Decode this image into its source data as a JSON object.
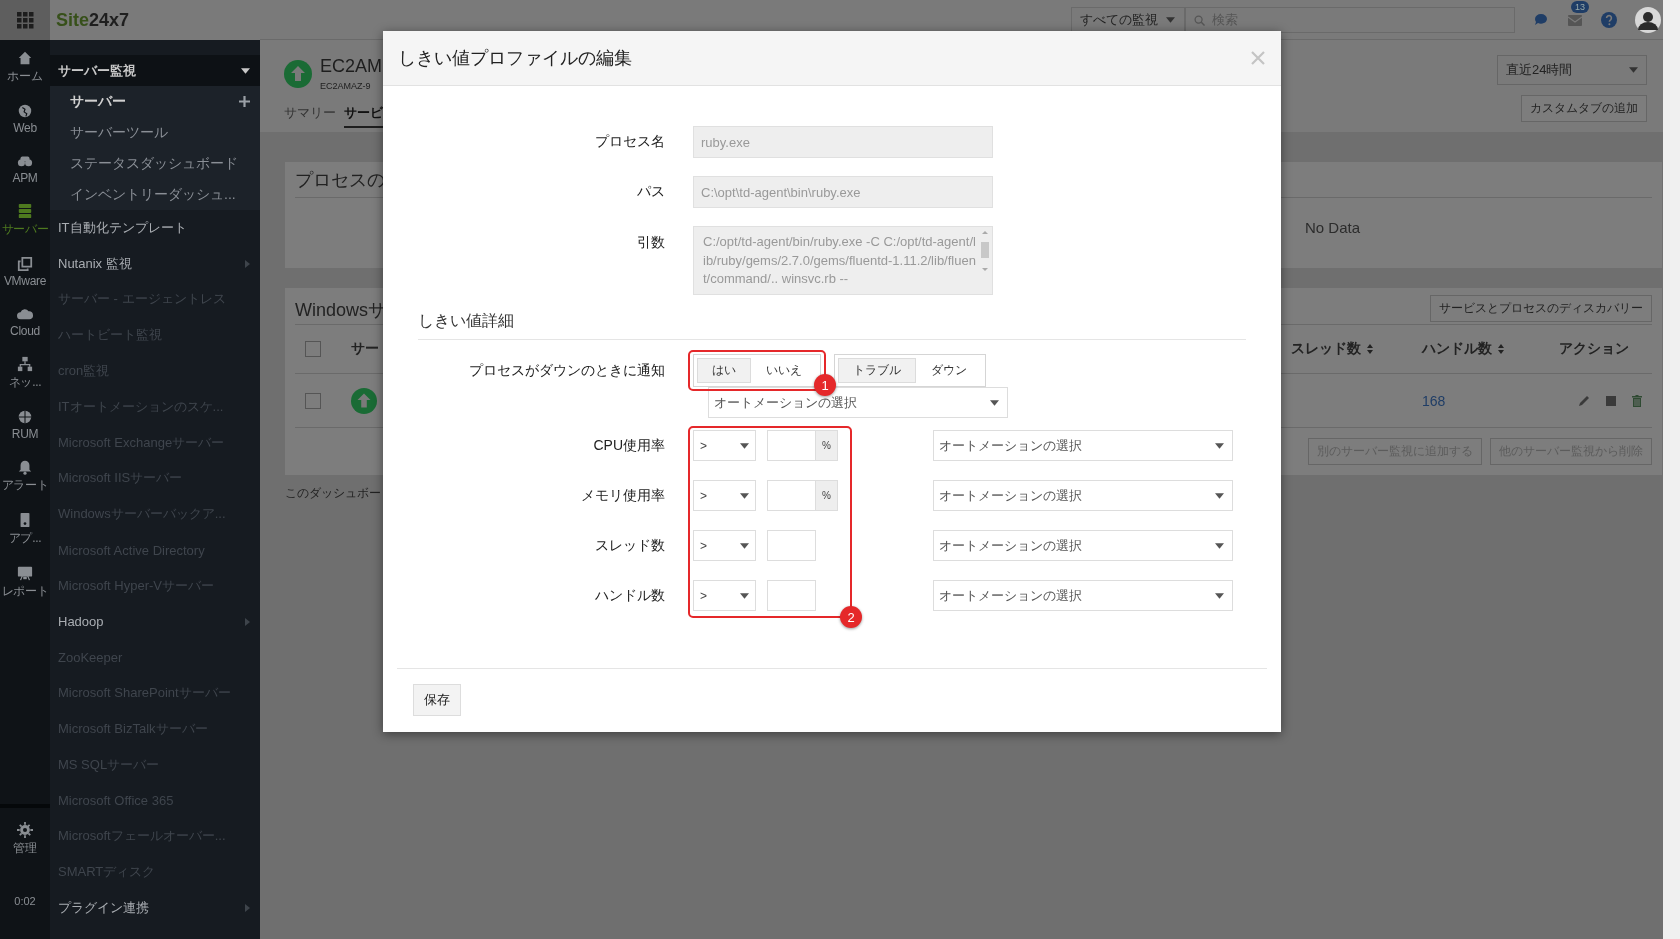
{
  "topbar": {
    "logo_first": "Site",
    "logo_second": "24x7",
    "monitor_filter": "すべての監視",
    "search": {
      "placeholder": "検索"
    },
    "notification_count": "13"
  },
  "icon_rail": [
    {
      "label": "ホーム",
      "selected": false
    },
    {
      "label": "Web",
      "selected": false
    },
    {
      "label": "APM",
      "selected": false
    },
    {
      "label": "サーバー",
      "selected": true
    },
    {
      "label": "VMware",
      "selected": false
    },
    {
      "label": "Cloud",
      "selected": false
    },
    {
      "label": "ネッ...",
      "selected": false
    },
    {
      "label": "RUM",
      "selected": false
    },
    {
      "label": "アラート",
      "selected": false
    },
    {
      "label": "アプ...",
      "selected": false
    },
    {
      "label": "レポート",
      "selected": false
    }
  ],
  "rail_bottom": {
    "admin": "管理",
    "time": "0:02"
  },
  "menu": [
    {
      "label": "サーバー監視",
      "kind": "group",
      "expanded": true,
      "children": [
        {
          "label": "サーバー",
          "selected": true
        },
        {
          "label": "サーバーツール",
          "selected": false
        },
        {
          "label": "ステータスダッシュボード",
          "selected": false
        },
        {
          "label": "インベントリーダッシュ...",
          "selected": false
        }
      ]
    },
    {
      "label": "IT自動化テンプレート",
      "kind": "item",
      "disabled": false
    },
    {
      "label": "Nutanix 監視",
      "kind": "category",
      "disabled": false
    },
    {
      "label": "サーバー - エージェントレス",
      "kind": "item",
      "disabled": true
    },
    {
      "label": "ハートビート監視",
      "kind": "item",
      "disabled": true
    },
    {
      "label": "cron監視",
      "kind": "item",
      "disabled": true
    },
    {
      "label": "ITオートメーションのスケ...",
      "kind": "item",
      "disabled": true
    },
    {
      "label": "Microsoft Exchangeサーバー",
      "kind": "item",
      "disabled": true
    },
    {
      "label": "Microsoft IISサーバー",
      "kind": "item",
      "disabled": true
    },
    {
      "label": "Windowsサーバーバックア...",
      "kind": "item",
      "disabled": true
    },
    {
      "label": "Microsoft Active Directory",
      "kind": "item",
      "disabled": true
    },
    {
      "label": "Microsoft Hyper-Vサーバー",
      "kind": "item",
      "disabled": true
    },
    {
      "label": "Hadoop",
      "kind": "category",
      "disabled": false
    },
    {
      "label": "ZooKeeper",
      "kind": "item",
      "disabled": true
    },
    {
      "label": "Microsoft SharePointサーバー",
      "kind": "item",
      "disabled": true
    },
    {
      "label": "Microsoft BizTalkサーバー",
      "kind": "item",
      "disabled": true
    },
    {
      "label": "MS SQLサーバー",
      "kind": "item",
      "disabled": true
    },
    {
      "label": "Microsoft Office 365",
      "kind": "item",
      "disabled": true
    },
    {
      "label": "Microsoftフェールオーバー...",
      "kind": "item",
      "disabled": true
    },
    {
      "label": "SMARTディスク",
      "kind": "item",
      "disabled": true
    },
    {
      "label": "プラグイン連携",
      "kind": "category",
      "disabled": false
    }
  ],
  "monitor_header": {
    "title": "EC2AM",
    "subtitle": "EC2AMAZ-9",
    "tabs": [
      {
        "label": "サマリー",
        "selected": false
      },
      {
        "label": "サービ",
        "selected": true
      }
    ],
    "time_range": "直近24時間",
    "custom_tab_button": "カスタムタブの追加"
  },
  "process_panel": {
    "title": "プロセスの",
    "empty_text": "No Data"
  },
  "services_panel": {
    "title": "Windowsサ",
    "discovery_button": "サービスとプロセスのディスカバリー",
    "select_all_checked": false,
    "columns": [
      "サー",
      "スレッド数",
      "ハンドル数",
      "アクション"
    ],
    "rows": [
      {
        "checked": false,
        "handles": "168"
      }
    ],
    "buttons": [
      "別のサーバー監視に追加する",
      "他のサーバー監視から削除"
    ],
    "footer_note": "このダッシュボー"
  },
  "modal": {
    "title": "しきい値プロファイルの編集",
    "fields": [
      {
        "label": "プロセス名",
        "value": "ruby.exe",
        "kind": "text"
      },
      {
        "label": "パス",
        "value": "C:\\opt\\td-agent\\bin\\ruby.exe",
        "kind": "text"
      },
      {
        "label": "引数",
        "value": "C:/opt/td-agent/bin/ruby.exe  -C  C:/opt/td-agent/lib/ruby/gems/2.7.0/gems/fluentd-1.11.2/lib/fluent/command/..  winsvc.rb --",
        "kind": "textarea"
      }
    ],
    "section_title": "しきい値詳細",
    "notify": {
      "label": "プロセスがダウンのときに通知",
      "options": [
        {
          "label": "はい",
          "selected": true
        },
        {
          "label": "いいえ",
          "selected": false
        }
      ],
      "severity": [
        {
          "label": "トラブル",
          "selected": true
        },
        {
          "label": "ダウン",
          "selected": false
        }
      ],
      "automation": "オートメーションの選択",
      "callout": "1"
    },
    "thresholds": {
      "callout": "2",
      "rows": [
        {
          "label": "CPU使用率",
          "operator": ">",
          "unit": "%",
          "automation": "オートメーションの選択"
        },
        {
          "label": "メモリ使用率",
          "operator": ">",
          "unit": "%",
          "automation": "オートメーションの選択"
        },
        {
          "label": "スレッド数",
          "operator": ">",
          "automation": "オートメーションの選択"
        },
        {
          "label": "ハンドル数",
          "operator": ">",
          "automation": "オートメーションの選択"
        }
      ]
    },
    "save_button": "保存"
  }
}
